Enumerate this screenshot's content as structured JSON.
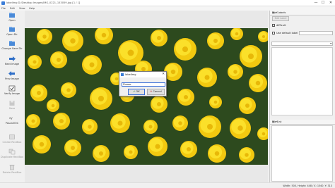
{
  "window": {
    "title": "labelImg D:/Desktop Images/IMG_0221_153059.jpg [1 / 1]",
    "controls": [
      "—",
      "☐",
      "✕"
    ]
  },
  "menu": [
    "File",
    "Edit",
    "View",
    "Help"
  ],
  "toolbar": [
    {
      "label": "Open",
      "icon": "folder-open-icon",
      "enabled": true
    },
    {
      "label": "Open Dir",
      "icon": "folder-dir-icon",
      "enabled": true
    },
    {
      "label": "Change Save Dir",
      "icon": "save-dir-icon",
      "enabled": true
    },
    {
      "label": "Next Image",
      "icon": "arrow-right-icon",
      "enabled": true
    },
    {
      "label": "Prev Image",
      "icon": "arrow-left-icon",
      "enabled": true
    },
    {
      "label": "Verify Image",
      "icon": "verify-icon",
      "enabled": true
    },
    {
      "label": "Save",
      "icon": "save-icon",
      "enabled": false
    },
    {
      "label": "PascalVOC",
      "icon": "format-icon",
      "enabled": true
    },
    {
      "label": "Create RectBox",
      "icon": "rect-icon",
      "enabled": false
    },
    {
      "label": "Duplicate RectBox",
      "icon": "duplicate-icon",
      "enabled": false
    },
    {
      "label": "Delete RectBox",
      "icon": "delete-icon",
      "enabled": false
    }
  ],
  "dialog": {
    "title": "labelImg",
    "close": "✕",
    "input_value": "Flower",
    "ok_label": "OK",
    "cancel_label": "Cancel"
  },
  "box_labels": {
    "title": "Box Labels",
    "edit_label": "Edit Label",
    "difficult_label": "difficult",
    "use_default_label": "Use default label",
    "default_label_value": ""
  },
  "file_list": {
    "title": "File List"
  },
  "panel_controls": "▣ ✕",
  "status": "Width: 500, Height: 448 / X: 1540; Y: 313",
  "colors": {
    "accent": "#3a6fd8",
    "flower": "#f7d414",
    "leaves": "#2d4a1e"
  }
}
